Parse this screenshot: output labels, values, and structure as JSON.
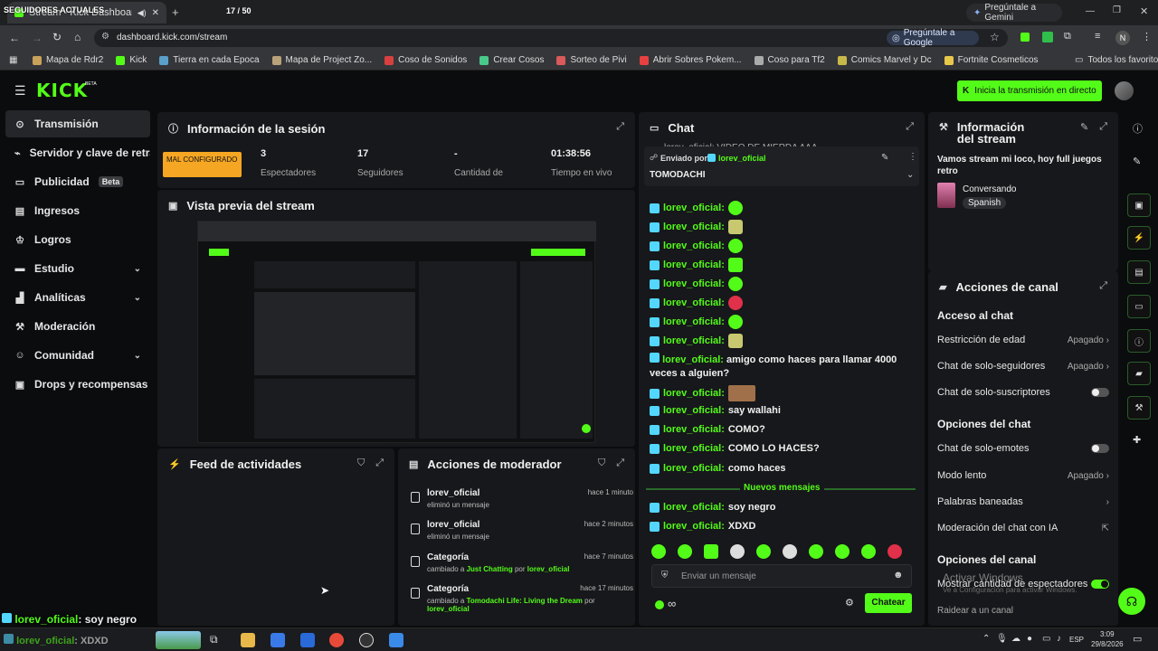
{
  "browser": {
    "tab_title": "Stream - Kick Dashboard",
    "overlay_top": "SEGUIDORES ACTUALES",
    "counter": "17 / 50",
    "gemini": "Pregúntale a Gemini",
    "url": "dashboard.kick.com/stream",
    "ask_google": "Pregúntale a Google",
    "profile_initial": "N",
    "bookmarks": [
      "Mapa de Rdr2",
      "Kick",
      "Tierra en cada Epoca",
      "Mapa de Project Zo...",
      "Coso de Sonidos",
      "Crear Cosos",
      "Sorteo de Pivi",
      "Abrir Sobres Pokem...",
      "Coso para Tf2",
      "Comics Marvel y Dc",
      "Fortnite Cosmeticos"
    ],
    "all_favorites": "Todos los favoritos"
  },
  "header": {
    "logo": "KICK",
    "logo_sup": "BETA",
    "start_button": "Inicia la transmisión en directo"
  },
  "sidebar": {
    "items": [
      {
        "label": "Transmisión",
        "icon": "stream-icon"
      },
      {
        "label": "Servidor y clave de retransmisión",
        "icon": "server-icon"
      },
      {
        "label": "Publicidad",
        "icon": "ads-icon",
        "badge": "Beta"
      },
      {
        "label": "Ingresos",
        "icon": "money-icon"
      },
      {
        "label": "Logros",
        "icon": "achievements-icon"
      },
      {
        "label": "Estudio",
        "icon": "studio-icon"
      },
      {
        "label": "Analíticas",
        "icon": "analytics-icon"
      },
      {
        "label": "Moderación",
        "icon": "moderation-icon"
      },
      {
        "label": "Comunidad",
        "icon": "community-icon"
      },
      {
        "label": "Drops y recompensas",
        "icon": "drops-icon"
      }
    ]
  },
  "session": {
    "title": "Información de la sesión",
    "badge": "MAL CONFIGURADO",
    "stats": [
      {
        "value": "3",
        "label": "Espectadores"
      },
      {
        "value": "17",
        "label": "Seguidores"
      },
      {
        "value": "-",
        "label": "Cantidad de"
      },
      {
        "value": "01:38:56",
        "label": "Tiempo en vivo"
      }
    ]
  },
  "preview": {
    "title": "Vista previa del stream"
  },
  "feed": {
    "title": "Feed de actividades"
  },
  "modactions": {
    "title": "Acciones de moderador",
    "items": [
      {
        "title": "lorev_oficial",
        "sub": "eliminó un mensaje",
        "time": "hace 1 minuto"
      },
      {
        "title": "lorev_oficial",
        "sub": "eliminó un mensaje",
        "time": "hace 2 minutos"
      },
      {
        "title": "Categoría",
        "sub_a": "cambiado a",
        "sub_b": "Just Chatting",
        "sub_c": "por",
        "sub_d": "lorev_oficial",
        "time": "hace 7 minutos"
      },
      {
        "title": "Categoría",
        "sub_a": "cambiado a",
        "sub_b": "Tomodachi Life: Living the Dream",
        "sub_c": "por",
        "sub_d": "lorev_oficial",
        "time": "hace 17 minutos"
      }
    ]
  },
  "chat": {
    "title": "Chat",
    "pinned_prefix": "Enviado por",
    "pinned_user": "lorev_oficial",
    "pinned_text": "TOMODACHI",
    "top_partial": "lorev_oficial: VIDEO DE MIERDA AAA",
    "lines": [
      {
        "user": "lorev_oficial:",
        "text": ""
      },
      {
        "user": "lorev_oficial:",
        "text": ""
      },
      {
        "user": "lorev_oficial:",
        "text": ""
      },
      {
        "user": "lorev_oficial:",
        "text": ""
      },
      {
        "user": "lorev_oficial:",
        "text": ""
      },
      {
        "user": "lorev_oficial:",
        "text": ""
      },
      {
        "user": "lorev_oficial:",
        "text": ""
      },
      {
        "user": "lorev_oficial:",
        "text": ""
      },
      {
        "user": "lorev_oficial:",
        "text": "amigo como haces para llamar 4000 veces a alguien?"
      },
      {
        "user": "lorev_oficial:",
        "text": ""
      },
      {
        "user": "lorev_oficial:",
        "text": "say wallahi"
      },
      {
        "user": "lorev_oficial:",
        "text": "COMO?"
      },
      {
        "user": "lorev_oficial:",
        "text": "COMO LO HACES?"
      },
      {
        "user": "lorev_oficial:",
        "text": "como haces"
      }
    ],
    "new_messages": "Nuevos mensajes",
    "new_lines": [
      {
        "user": "lorev_oficial:",
        "text": "soy negro"
      },
      {
        "user": "lorev_oficial:",
        "text": "XDXD"
      }
    ],
    "input_placeholder": "Enviar un mensaje",
    "infinity": "∞",
    "send": "Chatear"
  },
  "stream_info": {
    "title": "Información del stream",
    "description": "Vamos stream mi loco, hoy full juegos retro",
    "category": "Conversando",
    "language": "Spanish"
  },
  "channel": {
    "title": "Acciones de canal",
    "access_head": "Acceso al chat",
    "age": "Restricción de edad",
    "age_state": "Apagado",
    "followers": "Chat de solo-seguidores",
    "followers_state": "Apagado",
    "subs": "Chat de solo-suscriptores",
    "chat_opts_head": "Opciones del chat",
    "emotes": "Chat de solo-emotes",
    "slow": "Modo lento",
    "slow_state": "Apagado",
    "banned": "Palabras baneadas",
    "ai": "Moderación del chat con IA",
    "channel_opts_head": "Opciones del canal",
    "show_viewers": "Mostrar cantidad de espectadores",
    "raid": "Raidear a un canal",
    "watermark_1": "Activar Windows",
    "watermark_2": "Ve a Configuración para activar Windows."
  },
  "overlay": {
    "bottom_line_user": "lorev_oficial",
    "bottom_line_text": ": soy negro",
    "bottom_line2_user": "lorev_oficial",
    "bottom_line2_text": ": XDXD"
  },
  "taskbar": {
    "lang": "ESP",
    "time": "3:09",
    "date": "29/8/2026"
  },
  "colors": {
    "kick_green": "#53fc18",
    "badge_orange": "#f5a623",
    "panel_bg": "#17181b"
  }
}
